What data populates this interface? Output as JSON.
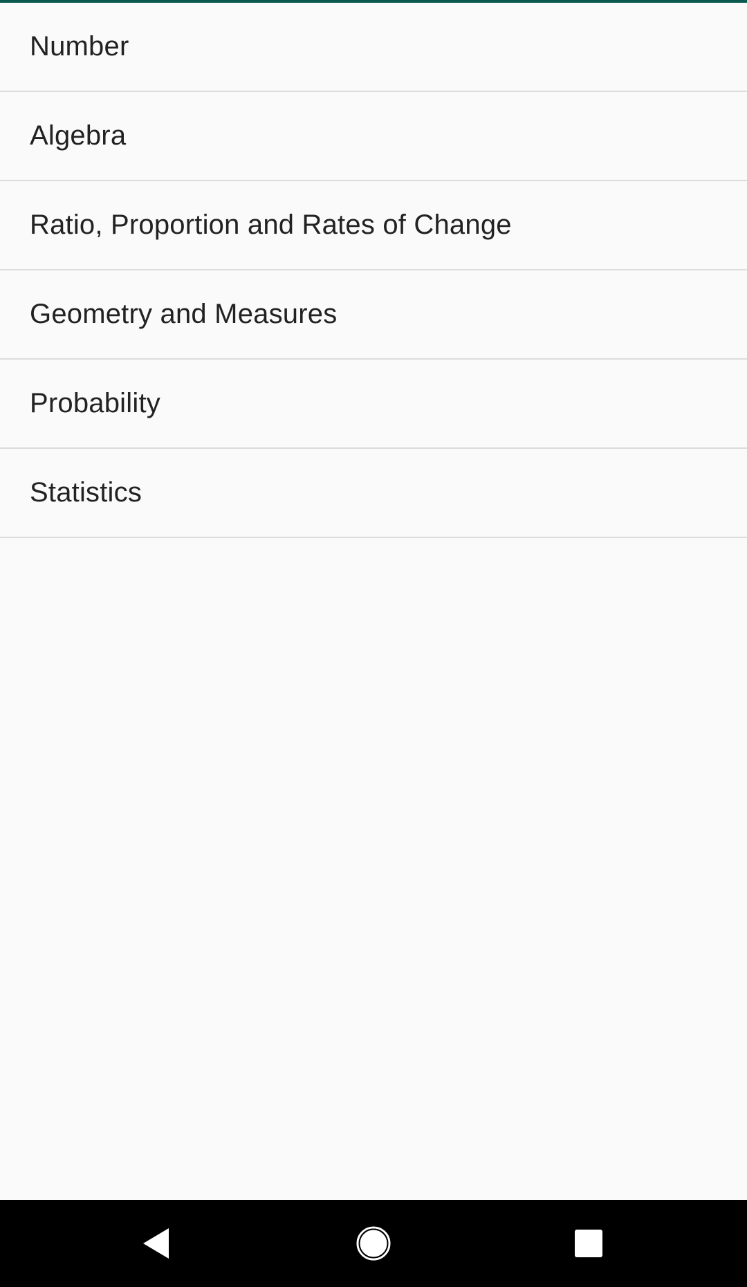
{
  "topics": [
    {
      "label": "Number"
    },
    {
      "label": "Algebra"
    },
    {
      "label": "Ratio, Proportion and Rates of Change"
    },
    {
      "label": "Geometry and Measures"
    },
    {
      "label": "Probability"
    },
    {
      "label": "Statistics"
    }
  ],
  "navigation_bar": {
    "back_icon": "back-triangle-icon",
    "home_icon": "home-circle-icon",
    "recents_icon": "recents-square-icon"
  },
  "colors": {
    "accent": "#0b5a4f",
    "background": "#fafafa",
    "divider": "#dcdcdc",
    "text": "#222222",
    "nav_bar": "#000000",
    "nav_icon": "#ffffff"
  }
}
